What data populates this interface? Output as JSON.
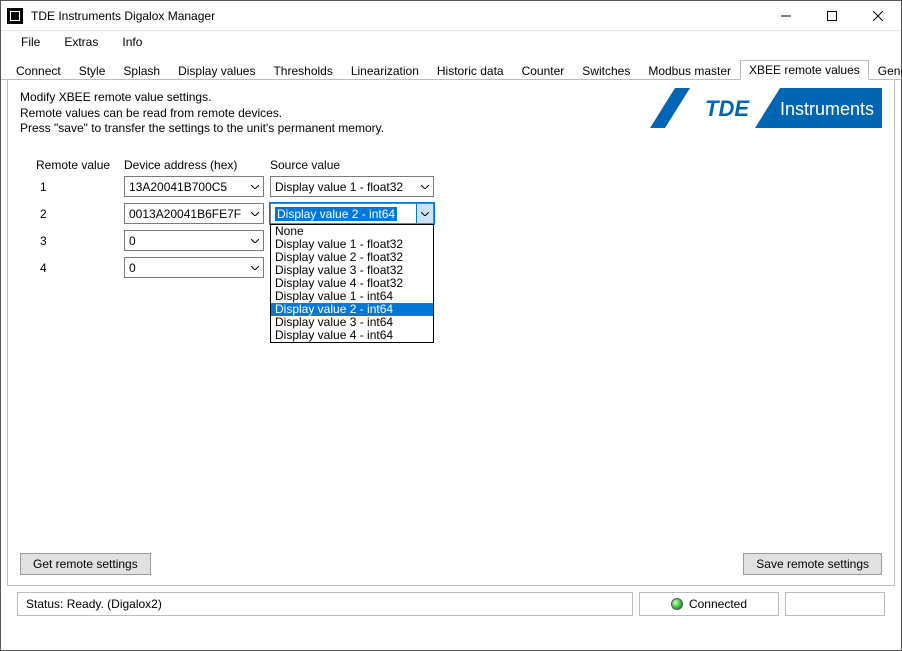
{
  "window": {
    "title": "TDE Instruments Digalox Manager"
  },
  "menu": {
    "file": "File",
    "extras": "Extras",
    "info": "Info"
  },
  "tabs": {
    "connect": "Connect",
    "style": "Style",
    "splash": "Splash",
    "display_values": "Display values",
    "thresholds": "Thresholds",
    "linearization": "Linearization",
    "historic_data": "Historic data",
    "counter": "Counter",
    "switches": "Switches",
    "modbus_master": "Modbus master",
    "xbee_remote_values": "XBEE remote values",
    "general": "General"
  },
  "instructions": {
    "l1": "Modify XBEE remote value settings.",
    "l2": "Remote values can be read from remote devices.",
    "l3": "Press \"save\" to transfer the settings to the unit's permanent memory."
  },
  "logo": {
    "brand": "TDE",
    "brand2": "Instruments"
  },
  "headers": {
    "remote_value": "Remote value",
    "device_address": "Device address (hex)",
    "source_value": "Source value"
  },
  "rows": {
    "r1": {
      "n": "1",
      "addr": "13A20041B700C5",
      "src": "Display value 1 - float32"
    },
    "r2": {
      "n": "2",
      "addr": "0013A20041B6FE7F",
      "src": "Display value 2 - int64"
    },
    "r3": {
      "n": "3",
      "addr": "0"
    },
    "r4": {
      "n": "4",
      "addr": "0"
    }
  },
  "dropdown_options": {
    "o0": "None",
    "o1": "Display value 1 - float32",
    "o2": "Display value 2 - float32",
    "o3": "Display value 3 - float32",
    "o4": "Display value 4 - float32",
    "o5": "Display value 1 - int64",
    "o6": "Display value 2 - int64",
    "o7": "Display value 3 - int64",
    "o8": "Display value 4 - int64"
  },
  "buttons": {
    "get": "Get remote settings",
    "save": "Save remote settings"
  },
  "status": {
    "text": "Status: Ready. (Digalox2)",
    "connected": "Connected"
  }
}
